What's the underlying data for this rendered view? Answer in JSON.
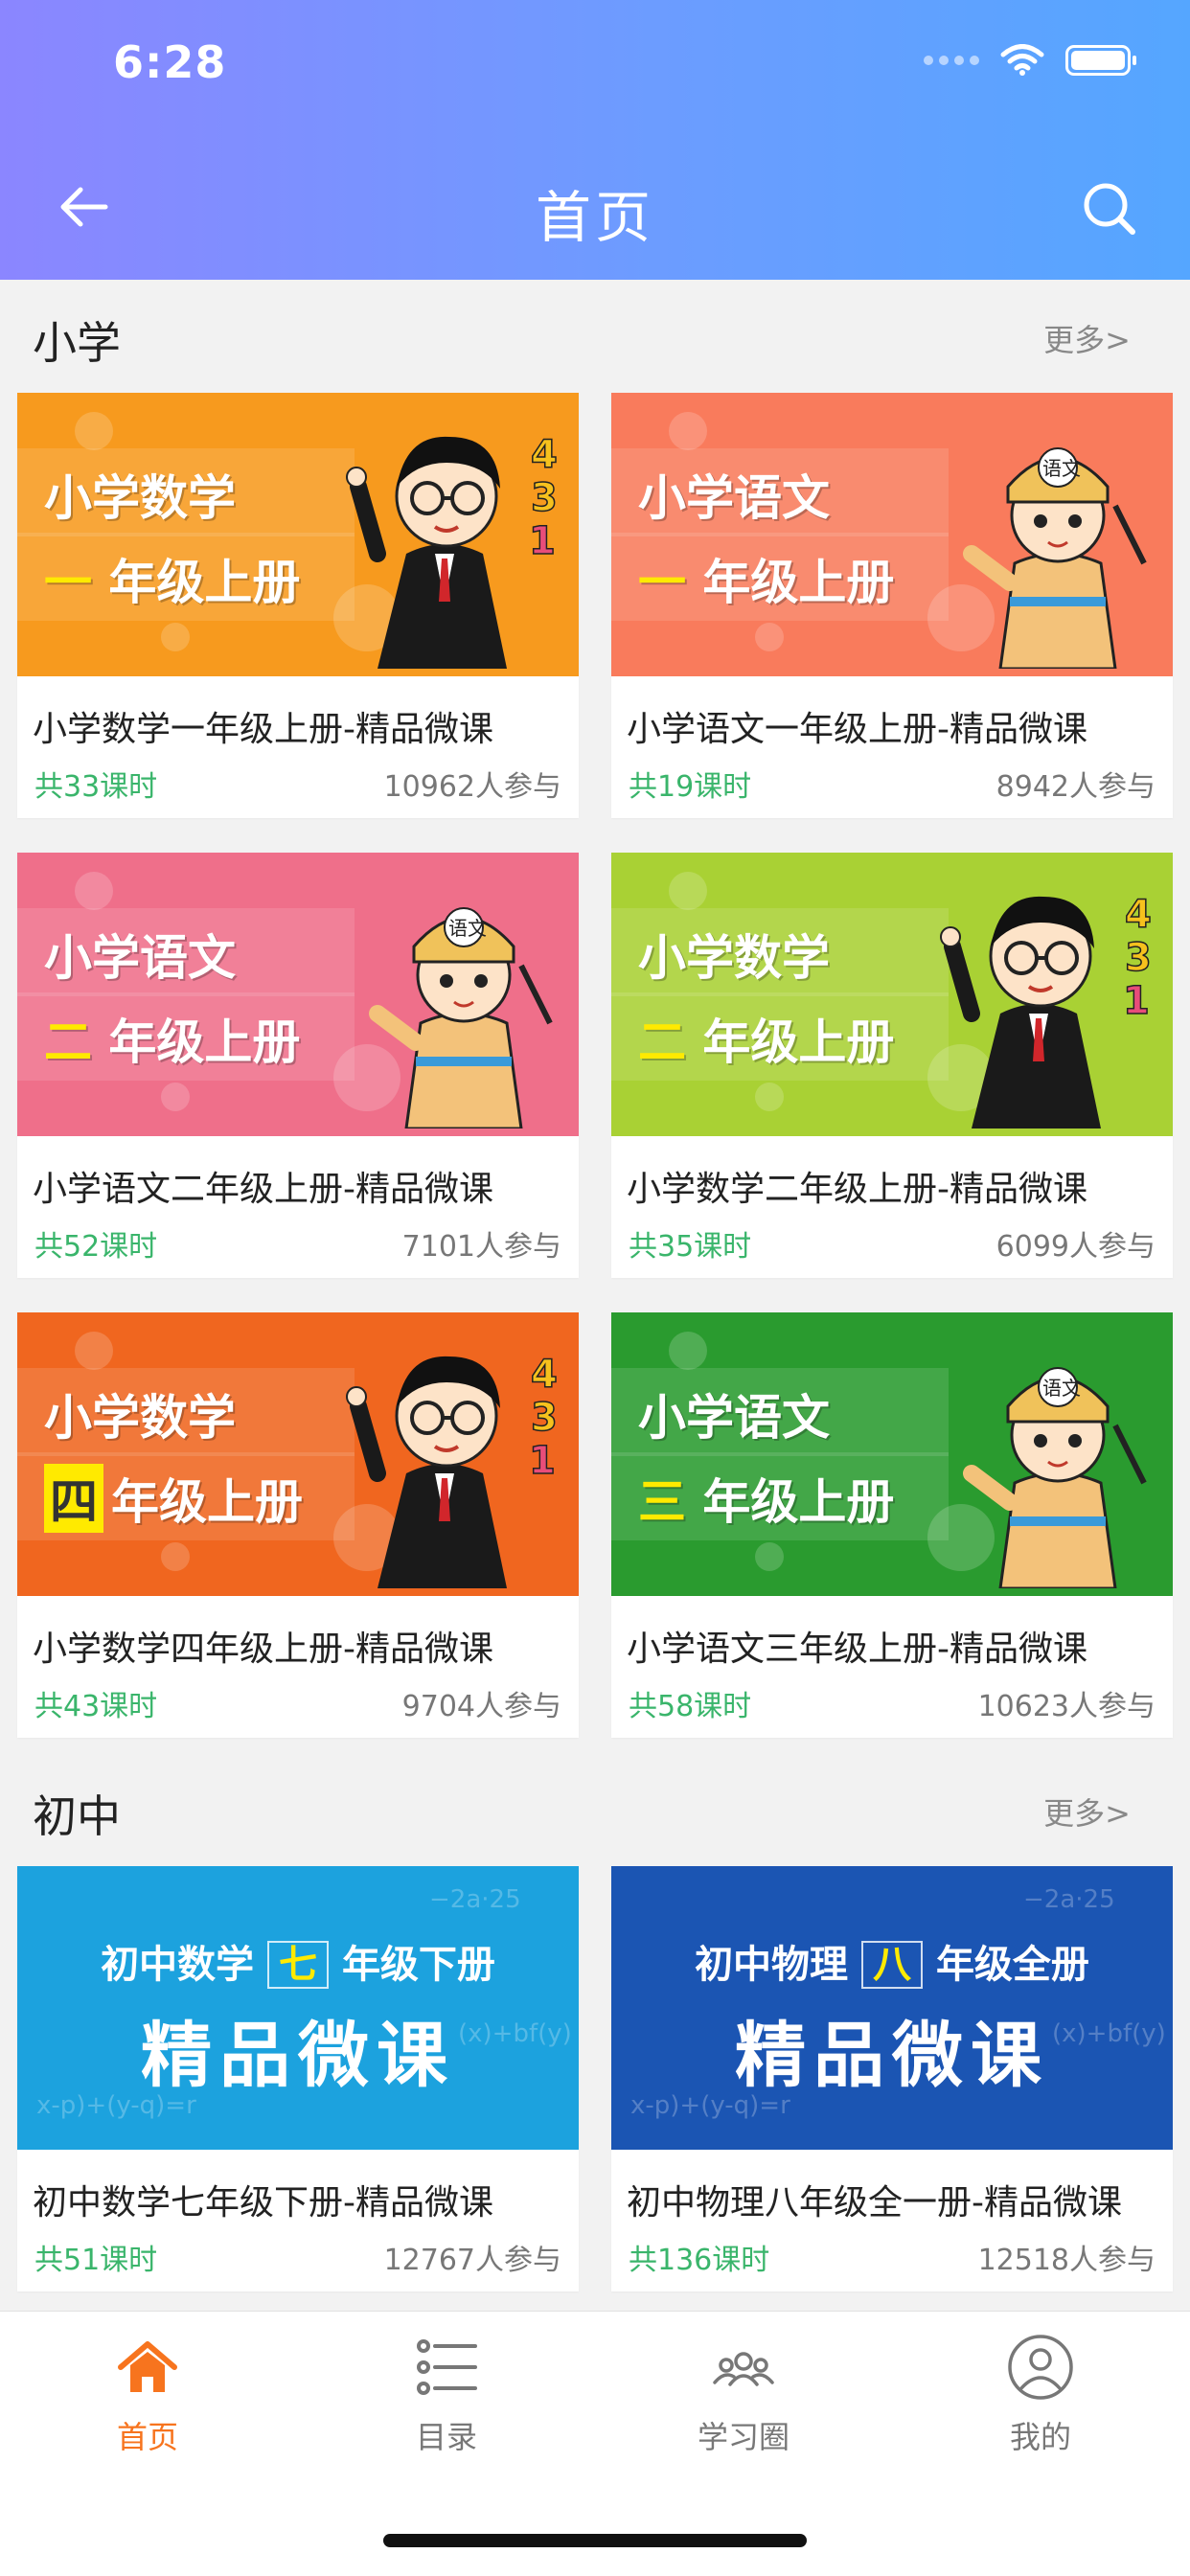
{
  "status_bar": {
    "time": "6:28"
  },
  "nav": {
    "title": "首页"
  },
  "sections": [
    {
      "title": "小学",
      "more": "更多>",
      "cards": [
        {
          "banner_line1": "小学数学",
          "banner_num": "一",
          "banner_line2": "年级上册",
          "name": "小学数学一年级上册-精品微课",
          "lessons": "共33课时",
          "count": "10962人参与",
          "bg": "#f79a1e"
        },
        {
          "banner_line1": "小学语文",
          "banner_num": "一",
          "banner_line2": "年级上册",
          "name": "小学语文一年级上册-精品微课",
          "lessons": "共19课时",
          "count": "8942人参与",
          "bg": "#f97b5c"
        },
        {
          "banner_line1": "小学语文",
          "banner_num": "二",
          "banner_line2": "年级上册",
          "name": "小学语文二年级上册-精品微课",
          "lessons": "共52课时",
          "count": "7101人参与",
          "bg": "#ef6f8a"
        },
        {
          "banner_line1": "小学数学",
          "banner_num": "二",
          "banner_line2": "年级上册",
          "name": "小学数学二年级上册-精品微课",
          "lessons": "共35课时",
          "count": "6099人参与",
          "bg": "#a9d134"
        },
        {
          "banner_line1": "小学数学",
          "banner_num": "四",
          "banner_line2": "年级上册",
          "name": "小学数学四年级上册-精品微课",
          "lessons": "共43课时",
          "count": "9704人参与",
          "bg": "#f0661f"
        },
        {
          "banner_line1": "小学语文",
          "banner_num": "三",
          "banner_line2": "年级上册",
          "name": "小学语文三年级上册-精品微课",
          "lessons": "共58课时",
          "count": "10623人参与",
          "bg": "#2a9b2f"
        }
      ]
    },
    {
      "title": "初中",
      "more": "更多>",
      "cards": [
        {
          "banner_top_a": "初中数学",
          "banner_top_num": "七",
          "banner_top_b": "年级下册",
          "banner_bottom": "精品微课",
          "name": "初中数学七年级下册-精品微课",
          "lessons": "共51课时",
          "count": "12767人参与",
          "bg": "#1ca2de"
        },
        {
          "banner_top_a": "初中物理",
          "banner_top_num": "八",
          "banner_top_b": "年级全册",
          "banner_bottom": "精品微课",
          "name": "初中物理八年级全一册-精品微课",
          "lessons": "共136课时",
          "count": "12518人参与",
          "bg": "#1b55b3"
        }
      ]
    }
  ],
  "tabs": [
    {
      "label": "首页",
      "icon": "home-icon",
      "active": true
    },
    {
      "label": "目录",
      "icon": "list-icon",
      "active": false
    },
    {
      "label": "学习圈",
      "icon": "group-icon",
      "active": false
    },
    {
      "label": "我的",
      "icon": "profile-icon",
      "active": false
    }
  ],
  "colors": {
    "accent": "#f7741e",
    "lesson_green": "#3ab56b"
  }
}
